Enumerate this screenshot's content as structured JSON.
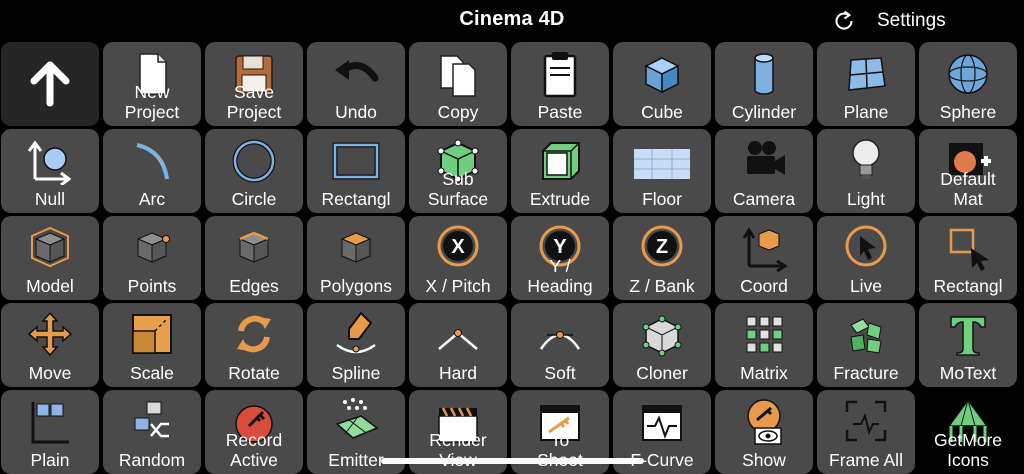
{
  "app": {
    "title": "Cinema 4D"
  },
  "header": {
    "settings_label": "Settings",
    "refresh_icon": "refresh-icon"
  },
  "tiles": [
    {
      "label": "",
      "icon": "arrow-up-icon"
    },
    {
      "label": "New\nProject",
      "icon": "new-document-icon"
    },
    {
      "label": "Save\nProject",
      "icon": "floppy-disk-icon"
    },
    {
      "label": "Undo",
      "icon": "undo-arrow-icon"
    },
    {
      "label": "Copy",
      "icon": "copy-documents-icon"
    },
    {
      "label": "Paste",
      "icon": "clipboard-icon"
    },
    {
      "label": "Cube",
      "icon": "cube-icon"
    },
    {
      "label": "Cylinder",
      "icon": "cylinder-icon"
    },
    {
      "label": "Plane",
      "icon": "plane-icon"
    },
    {
      "label": "Sphere",
      "icon": "sphere-icon"
    },
    {
      "label": "Null",
      "icon": "null-axes-icon"
    },
    {
      "label": "Arc",
      "icon": "arc-icon"
    },
    {
      "label": "Circle",
      "icon": "circle-icon"
    },
    {
      "label": "Rectangl",
      "icon": "rectangle-icon"
    },
    {
      "label": "Sub\nSurface",
      "icon": "subdivision-surface-icon"
    },
    {
      "label": "Extrude",
      "icon": "extrude-icon"
    },
    {
      "label": "Floor",
      "icon": "floor-icon"
    },
    {
      "label": "Camera",
      "icon": "movie-camera-icon"
    },
    {
      "label": "Light",
      "icon": "light-bulb-icon"
    },
    {
      "label": "Default\nMat",
      "icon": "material-icon"
    },
    {
      "label": "Model",
      "icon": "model-mode-icon"
    },
    {
      "label": "Points",
      "icon": "points-mode-icon"
    },
    {
      "label": "Edges",
      "icon": "edges-mode-icon"
    },
    {
      "label": "Polygons",
      "icon": "polygons-mode-icon"
    },
    {
      "label": "X / Pitch",
      "icon": "x-axis-icon"
    },
    {
      "label": "Y /\nHeading",
      "icon": "y-axis-icon"
    },
    {
      "label": "Z / Bank",
      "icon": "z-axis-icon"
    },
    {
      "label": "Coord",
      "icon": "coordinate-system-icon"
    },
    {
      "label": "Live",
      "icon": "live-selection-icon"
    },
    {
      "label": "Rectangl",
      "icon": "rectangle-selection-icon"
    },
    {
      "label": "Move",
      "icon": "move-icon"
    },
    {
      "label": "Scale",
      "icon": "scale-icon"
    },
    {
      "label": "Rotate",
      "icon": "rotate-icon"
    },
    {
      "label": "Spline",
      "icon": "spline-pen-icon"
    },
    {
      "label": "Hard",
      "icon": "hard-interpolation-icon"
    },
    {
      "label": "Soft",
      "icon": "soft-interpolation-icon"
    },
    {
      "label": "Cloner",
      "icon": "cloner-icon"
    },
    {
      "label": "Matrix",
      "icon": "matrix-icon"
    },
    {
      "label": "Fracture",
      "icon": "fracture-icon"
    },
    {
      "label": "MoText",
      "icon": "motext-icon"
    },
    {
      "label": "Plain",
      "icon": "plain-effector-icon"
    },
    {
      "label": "Random",
      "icon": "random-effector-icon"
    },
    {
      "label": "Record\nActive",
      "icon": "record-key-icon"
    },
    {
      "label": "Emitter",
      "icon": "emitter-icon"
    },
    {
      "label": "Render\nView",
      "icon": "clapperboard-icon"
    },
    {
      "label": "To\nSheet",
      "icon": "key-sheet-icon"
    },
    {
      "label": "F-Curve",
      "icon": "f-curve-icon"
    },
    {
      "label": "Show",
      "icon": "show-key-icon"
    },
    {
      "label": "Frame All",
      "icon": "frame-all-icon"
    },
    {
      "label": "GetMore\nIcons",
      "icon": "circus-tent-icon"
    }
  ]
}
